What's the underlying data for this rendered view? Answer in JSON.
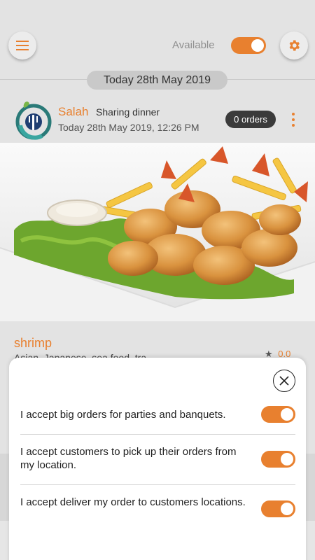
{
  "header": {
    "available_label": "Available",
    "available_on": true,
    "accent_color": "#e8802f"
  },
  "date_label": "Today 28th May 2019",
  "post": {
    "poster_name": "Salah",
    "post_type": "Sharing dinner",
    "timestamp": "Today 28th May 2019, 12:26 PM",
    "orders_badge": "0 orders",
    "dish_name": "shrimp",
    "dish_tags": "Asian, Japanese, sea food, tra",
    "rating": "0.0"
  },
  "sheet": {
    "options": [
      {
        "label": "I accept big orders for parties and banquets.",
        "enabled": true
      },
      {
        "label": "I accept customers to pick up their orders from my location.",
        "enabled": true
      },
      {
        "label": "I accept deliver my order to customers locations.",
        "enabled": true
      }
    ]
  },
  "icons": {
    "menu": "hamburger-icon",
    "settings": "gear-icon",
    "more": "more-vert-icon",
    "close": "close-icon",
    "star": "star-icon"
  }
}
